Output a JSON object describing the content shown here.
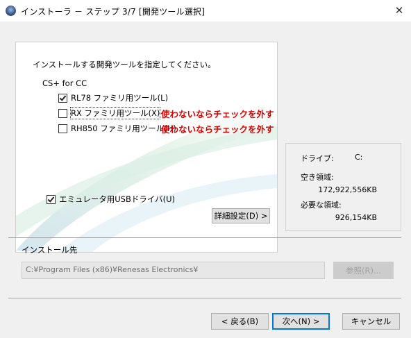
{
  "window": {
    "title": "インストーラ － ステップ 3/7 [開発ツール選択]",
    "close_glyph": "✕"
  },
  "panel": {
    "instruction": "インストールする開発ツールを指定してください。",
    "group_label": "CS+ for CC",
    "options": [
      {
        "label": "RL78 ファミリ用ツール(L)",
        "checked": true
      },
      {
        "label": "RX ファミリ用ツール(X)",
        "checked": false
      },
      {
        "label": "RH850 ファミリ用ツール(H)",
        "checked": false
      }
    ],
    "notes": [
      "使わないならチェックを外す",
      "使わないならチェックを外す"
    ],
    "usb_driver": {
      "label": "エミュレータ用USBドライバ(U)",
      "checked": true
    },
    "details_button": "詳細設定(D) >"
  },
  "disk": {
    "drive_label": "ドライブ:",
    "drive_value": "C:",
    "free_label": "空き領域:",
    "free_value": "172,922,556KB",
    "required_label": "必要な領域:",
    "required_value": "926,154KB"
  },
  "destination": {
    "label": "インストール先",
    "path": "C:¥Program Files (x86)¥Renesas Electronics¥",
    "browse_button": "参照(R)..."
  },
  "footer": {
    "back_button": "< 戻る(B)",
    "next_button": "次へ(N) >",
    "cancel_button": "キャンセル"
  }
}
